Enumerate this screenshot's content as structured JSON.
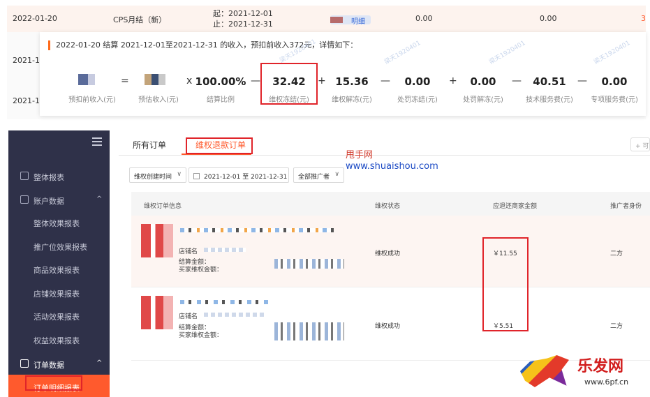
{
  "settlement": {
    "rows": [
      {
        "date": "2022-01-20",
        "type": "CPS月结（新）",
        "start": "起：2021-12-01",
        "end": "止：2021-12-31",
        "link": "明细",
        "v1": "0.00",
        "v2": "0.00",
        "v3": "3"
      },
      {
        "date": "2021-1"
      },
      {
        "date": "2021-1"
      }
    ],
    "tooltip_head": "2022-01-20 结算 2021-12-01至2021-12-31 的收入，预扣前收入372元，详情如下：",
    "formula": [
      {
        "value": "",
        "label": "预扣前收入(元)"
      },
      {
        "value": "",
        "label": "预估收入(元)"
      },
      {
        "value": "100.00%",
        "label": "结算比例"
      },
      {
        "value": "32.42",
        "label": "维权冻结(元)"
      },
      {
        "value": "15.36",
        "label": "维权解冻(元)"
      },
      {
        "value": "0.00",
        "label": "处罚冻结(元)"
      },
      {
        "value": "0.00",
        "label": "处罚解冻(元)"
      },
      {
        "value": "40.51",
        "label": "技术服务费(元)"
      },
      {
        "value": "0.00",
        "label": "专项服务费(元)"
      }
    ],
    "operators": [
      "=",
      "x",
      "—",
      "+",
      "—",
      "+",
      "—",
      "—"
    ],
    "watermark": "梁天1920401"
  },
  "sidebar": {
    "items": [
      {
        "label": "整体报表"
      },
      {
        "label": "账户数据",
        "chevron": "^"
      },
      {
        "label": "整体效果报表"
      },
      {
        "label": "推广位效果报表"
      },
      {
        "label": "商品效果报表"
      },
      {
        "label": "店铺效果报表"
      },
      {
        "label": "活动效果报表"
      },
      {
        "label": "权益效果报表"
      },
      {
        "label": "订单数据",
        "chevron": "^"
      },
      {
        "label": "订单明细报表"
      }
    ]
  },
  "main": {
    "tabs": [
      {
        "label": "所有订单"
      },
      {
        "label": "维权退款订单"
      }
    ],
    "right_btn": "+ 可",
    "filters": {
      "type": "维权创建时间",
      "date_start": "2021-12-01",
      "date_sep": "至",
      "date_end": "2021-12-31",
      "promoter": "全部推广者"
    },
    "overlay_name": "甩手网",
    "overlay_url": "www.shuaishou.com",
    "table": {
      "headers": [
        "维权订单信息",
        "维权状态",
        "应退还商家金额",
        "推广者身份"
      ],
      "rows": [
        {
          "shop": "店铺名",
          "settle": "结算金额：",
          "buyer": "买家维权金额：",
          "status": "维权成功",
          "amount": "￥11.55",
          "role": "二方"
        },
        {
          "shop": "店铺名",
          "settle": "结算金额：",
          "buyer": "买家维权金额：",
          "status": "维权成功",
          "amount": "￥5.51",
          "role": "二方"
        }
      ]
    }
  },
  "logo": {
    "name": "乐发网",
    "url": "www.6pf.cn"
  }
}
